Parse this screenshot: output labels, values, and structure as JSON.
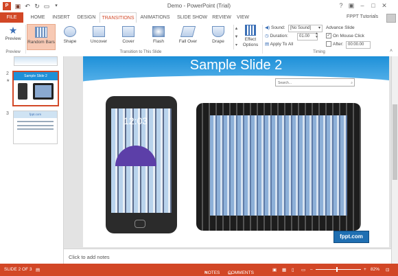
{
  "window": {
    "title": "Demo - PowerPoint (Trial)",
    "account": "FPPT Tutorials",
    "help": "?"
  },
  "tabs": [
    "FILE",
    "HOME",
    "INSERT",
    "DESIGN",
    "TRANSITIONS",
    "ANIMATIONS",
    "SLIDE SHOW",
    "REVIEW",
    "VIEW"
  ],
  "ribbon": {
    "preview_label": "Preview",
    "preview_group": "Preview",
    "effects": [
      "Random Bars",
      "Shape",
      "Uncover",
      "Cover",
      "Flash",
      "Fall Over",
      "Drape"
    ],
    "effects_group": "Transition to This Slide",
    "effect_options_line1": "Effect",
    "effect_options_line2": "Options",
    "sound_label": "Sound:",
    "sound_value": "[No Sound]",
    "duration_label": "Duration:",
    "duration_value": "01.00",
    "apply_all": "Apply To All",
    "advance_title": "Advance Slide",
    "on_mouse_click": "On Mouse Click",
    "after_label": "After:",
    "after_value": "00:00.00",
    "timing_group": "Timing"
  },
  "thumbnails": {
    "numbers": [
      "2",
      "3"
    ],
    "slide2_title": "Sample Slide 2",
    "slide3_title": "fppt.com"
  },
  "slide": {
    "title": "Sample Slide 2",
    "search_placeholder": "Search...",
    "brand": "fppt.com",
    "phone_time": "12:03"
  },
  "notes": {
    "placeholder": "Click to add notes"
  },
  "status": {
    "slide_counter": "SLIDE 2 OF 3",
    "notes": "NOTES",
    "comments": "COMMENTS",
    "zoom": "82%"
  },
  "colors": {
    "accent": "#d24726",
    "slide_blue": "#1e90d8"
  }
}
